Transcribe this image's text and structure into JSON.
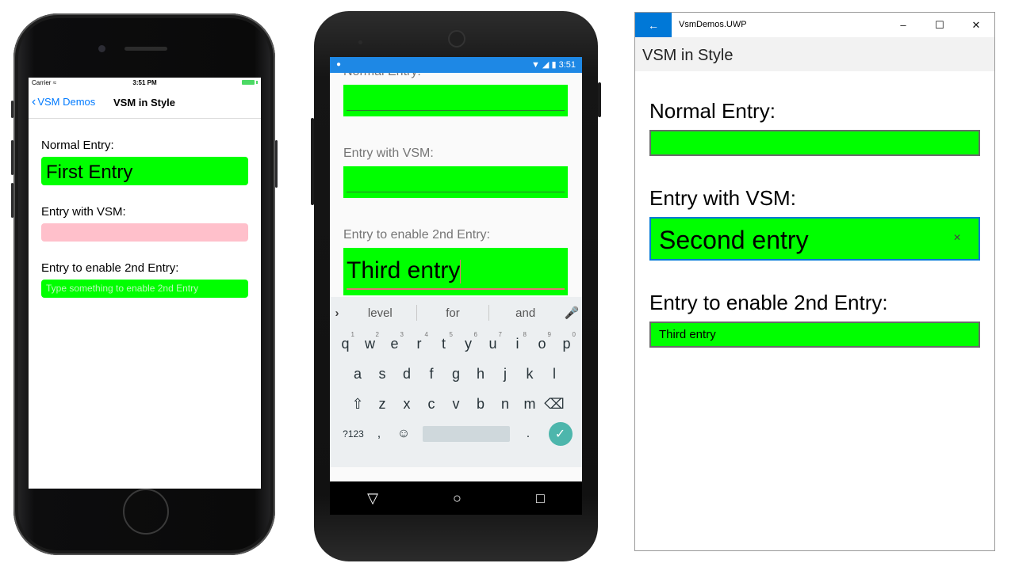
{
  "ios": {
    "status": {
      "carrier": "Carrier",
      "time": "3:51 PM"
    },
    "nav": {
      "back_label": "VSM Demos",
      "title": "VSM in Style"
    },
    "fields": [
      {
        "label": "Normal Entry:",
        "value": "First Entry"
      },
      {
        "label": "Entry with VSM:",
        "value": ""
      },
      {
        "label": "Entry to enable 2nd Entry:",
        "placeholder": "Type something to enable 2nd Entry"
      }
    ]
  },
  "android": {
    "status": {
      "time": "3:51"
    },
    "fields": [
      {
        "label": "Normal Entry:",
        "value": ""
      },
      {
        "label": "Entry with VSM:",
        "value": ""
      },
      {
        "label": "Entry to enable 2nd Entry:",
        "value": "Third entry"
      }
    ],
    "keyboard": {
      "suggestions": [
        "level",
        "for",
        "and"
      ],
      "row1": [
        "q",
        "w",
        "e",
        "r",
        "t",
        "y",
        "u",
        "i",
        "o",
        "p"
      ],
      "row1_hints": [
        "1",
        "2",
        "3",
        "4",
        "5",
        "6",
        "7",
        "8",
        "9",
        "0"
      ],
      "row2": [
        "a",
        "s",
        "d",
        "f",
        "g",
        "h",
        "j",
        "k",
        "l"
      ],
      "row3": [
        "z",
        "x",
        "c",
        "v",
        "b",
        "n",
        "m"
      ],
      "symbols_key": "?123",
      "comma_key": ",",
      "period_key": "."
    }
  },
  "uwp": {
    "app_name": "VsmDemos.UWP",
    "page_title": "VSM in Style",
    "fields": [
      {
        "label": "Normal Entry:",
        "value": ""
      },
      {
        "label": "Entry with VSM:",
        "value": "Second entry"
      },
      {
        "label": "Entry to enable 2nd Entry:",
        "value": "Third entry"
      }
    ]
  },
  "colors": {
    "entry_green": "#00ff00",
    "entry_pink": "#ffc0cb",
    "ios_blue": "#007aff",
    "android_status": "#1e88e5",
    "uwp_accent": "#0078d7"
  }
}
